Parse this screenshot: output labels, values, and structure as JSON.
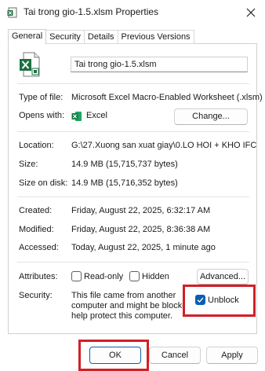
{
  "window": {
    "title": "Tai trong gio-1.5.xlsm Properties"
  },
  "tabs": [
    {
      "label": "General",
      "active": true
    },
    {
      "label": "Security",
      "active": false
    },
    {
      "label": "Details",
      "active": false
    },
    {
      "label": "Previous Versions",
      "active": false
    }
  ],
  "file": {
    "name": "Tai trong gio-1.5.xlsm"
  },
  "info": {
    "type_label": "Type of file:",
    "type_value": "Microsoft Excel Macro-Enabled Worksheet (.xlsm)",
    "opens_label": "Opens with:",
    "opens_value": "Excel",
    "change_button": "Change...",
    "location_label": "Location:",
    "location_value": "G:\\27.Xuong san xuat giay\\0.LO HOI + KHO IFC",
    "size_label": "Size:",
    "size_value": "14.9 MB (15,715,737 bytes)",
    "size_disk_label": "Size on disk:",
    "size_disk_value": "14.9 MB (15,716,352 bytes)",
    "created_label": "Created:",
    "created_value": "Friday, August 22, 2025, 6:32:17 AM",
    "modified_label": "Modified:",
    "modified_value": "Friday, August 22, 2025, 8:36:38 AM",
    "accessed_label": "Accessed:",
    "accessed_value": "Today, August 22, 2025, 1 minute ago"
  },
  "attributes": {
    "label": "Attributes:",
    "readonly_label": "Read-only",
    "readonly_checked": false,
    "hidden_label": "Hidden",
    "hidden_checked": false,
    "advanced_button": "Advanced..."
  },
  "security": {
    "label": "Security:",
    "line1": "This file came from another",
    "line2": "computer and might be blocked to",
    "line3": "help protect this computer.",
    "unblock_label": "Unblock",
    "unblock_checked": true
  },
  "buttons": {
    "ok": "OK",
    "cancel": "Cancel",
    "apply": "Apply"
  },
  "colors": {
    "highlight": "#d21f27",
    "check": "#0a5fb4",
    "excel": "#1d7044"
  }
}
